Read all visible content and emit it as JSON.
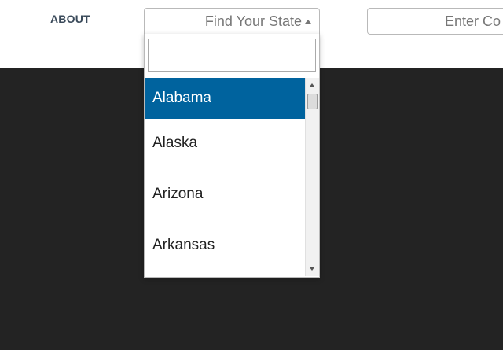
{
  "nav": {
    "about_label": "ABOUT"
  },
  "state_select": {
    "selected_text": "Find Your State",
    "search_value": "",
    "options": [
      {
        "label": "Alabama",
        "selected": true
      },
      {
        "label": "Alaska",
        "selected": false
      },
      {
        "label": "Arizona",
        "selected": false
      },
      {
        "label": "Arkansas",
        "selected": false
      }
    ]
  },
  "code_input": {
    "placeholder": "Enter Co"
  },
  "colors": {
    "hero_background": "#232323",
    "selected_option": "#00639e",
    "nav_text": "#3a4a5a"
  },
  "icons": {
    "select_caret": "caret-up-icon",
    "scroll_up": "scroll-up-arrow-icon",
    "scroll_down": "scroll-down-arrow-icon"
  }
}
